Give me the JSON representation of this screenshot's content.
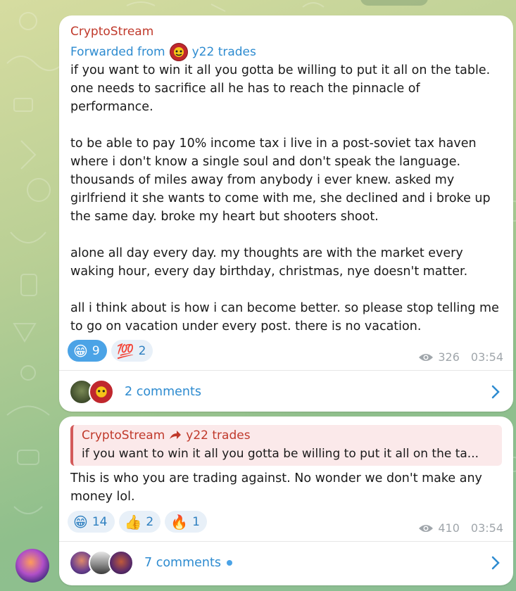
{
  "post1": {
    "sender": "CryptoStream",
    "forwarded_prefix": "Forwarded from",
    "forwarded_name": "y22 trades",
    "body": "if you want to win it all you gotta be willing to put it all on the table. one needs to sacrifice all he has to reach the pinnacle of performance.\n\nto be able to pay 10% income tax i live in a post-soviet tax haven where i don't know a single soul and don't speak the language. thousands of miles away from anybody i ever knew. asked my girlfriend it she wants to come with me, she declined and i broke up the same day. broke my heart but shooters shoot.\n\nalone all day every day. my thoughts are with the market every waking hour, every day birthday, christmas, nye doesn't matter.\n\nall i think about is how i can become better. so please stop telling me to go on vacation under every post. there is no vacation.",
    "reactions": [
      {
        "emoji": "😁",
        "count": "9"
      },
      {
        "emoji": "💯",
        "count": "2"
      }
    ],
    "views": "326",
    "time": "03:54",
    "comments_label": "2 comments"
  },
  "post2": {
    "reply_sender": "CryptoStream",
    "reply_target": "y22 trades",
    "reply_excerpt": "if you want to win it all you gotta be willing to put it all on the ta...",
    "body": "This is who you are trading against. No wonder we don't make any money lol.",
    "reactions": [
      {
        "emoji": "😁",
        "count": "14"
      },
      {
        "emoji": "👍",
        "count": "2"
      },
      {
        "emoji": "🔥",
        "count": "1"
      }
    ],
    "views": "410",
    "time": "03:54",
    "comments_label": "7 comments"
  },
  "colors": {
    "sender": "#c0392b",
    "link": "#2d8bd0",
    "reaction_active": "#4ba3e6",
    "reaction_bg": "#e8f0f8",
    "reply_bg": "#fbe9ea",
    "reply_bar": "#d35a5a"
  },
  "icons": {
    "views": "eye-icon",
    "comments_open": "chevron-right-icon",
    "forward": "forward-arrow-icon"
  }
}
